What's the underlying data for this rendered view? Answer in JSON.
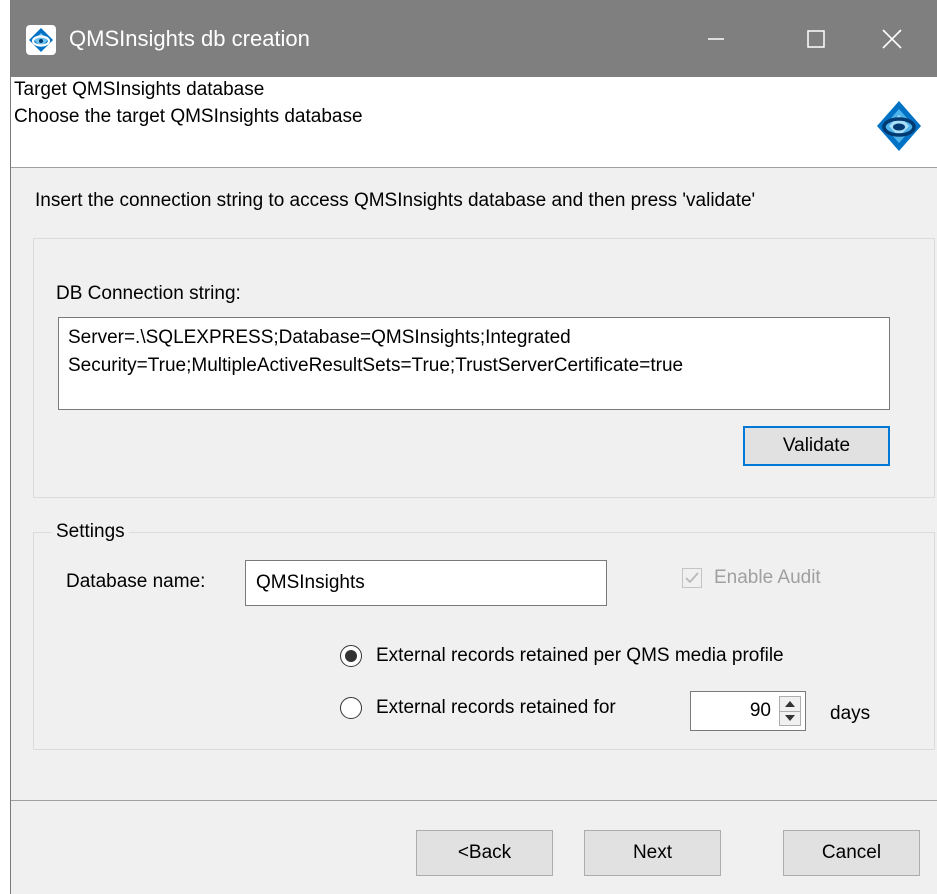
{
  "window": {
    "title": "QMSInsights db creation",
    "app_icon": "qmsinsights-logo",
    "titlebar_color": "#7f7f7f"
  },
  "header": {
    "title": "Target QMSInsights database",
    "subtitle": "Choose the target QMSInsights database",
    "logo_icon": "qmsinsights-logo",
    "logo_color": "#0072c6"
  },
  "instructions": "Insert the connection string to access QMSInsights database and then press 'validate'",
  "connection": {
    "label": "DB Connection string:",
    "value": "Server=.\\SQLEXPRESS;Database=QMSInsights;Integrated Security=True;MultipleActiveResultSets=True;TrustServerCertificate=true",
    "validate_label": "Validate"
  },
  "settings": {
    "legend": "Settings",
    "db_name_label": "Database name:",
    "db_name_value": "QMSInsights",
    "audit_label": "Enable Audit",
    "audit_checked": true,
    "audit_enabled": false,
    "retention_options": [
      {
        "label": "External records retained per QMS media profile",
        "selected": true
      },
      {
        "label": "External records retained for",
        "selected": false
      }
    ],
    "retention_days": "90",
    "days_label": "days"
  },
  "footer": {
    "back_label": "<Back",
    "next_label": "Next",
    "cancel_label": "Cancel"
  },
  "colors": {
    "accent": "#0078d7",
    "dialog_bg": "#f0f0f0",
    "disabled_text": "#a0a0a0"
  }
}
